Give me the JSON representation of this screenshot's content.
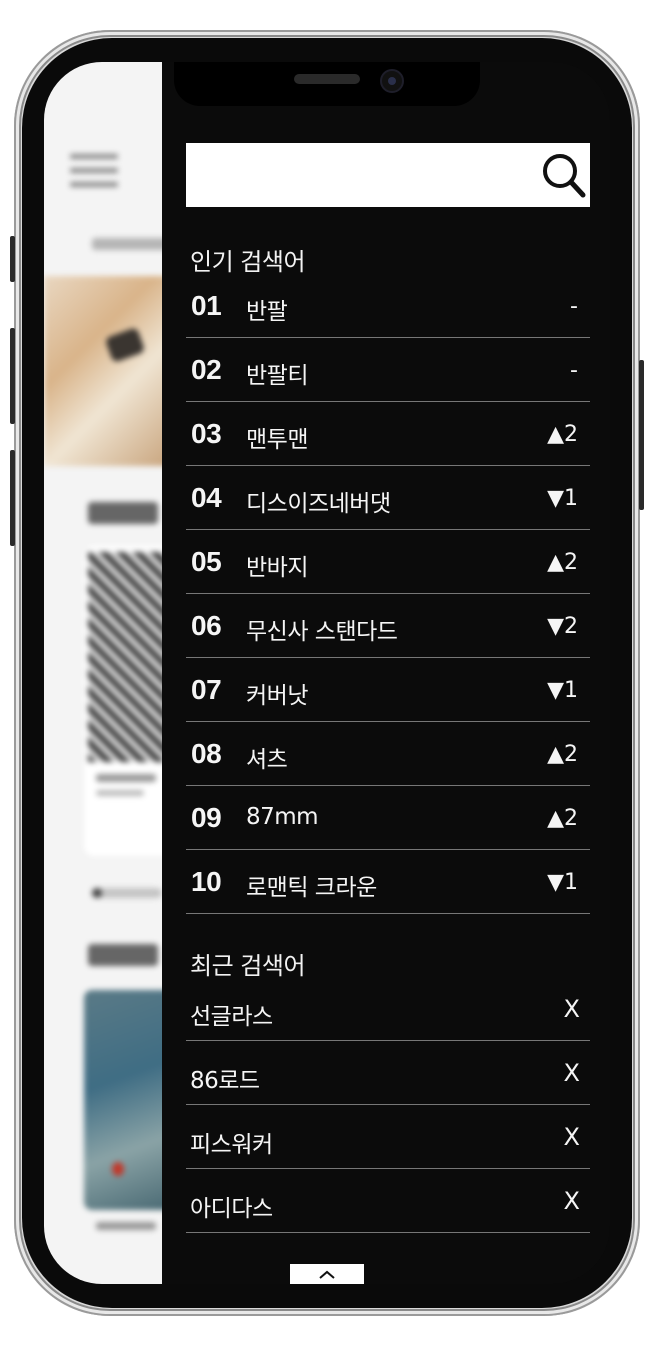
{
  "search": {
    "value": "",
    "placeholder": ""
  },
  "icons": {
    "search": "search-icon",
    "collapse": "chevron-up-icon"
  },
  "popular": {
    "title": "인기 검색어",
    "items": [
      {
        "rank": "01",
        "keyword": "반팔",
        "change": "-"
      },
      {
        "rank": "02",
        "keyword": "반팔티",
        "change": "-"
      },
      {
        "rank": "03",
        "keyword": "맨투맨",
        "change": "▲2"
      },
      {
        "rank": "04",
        "keyword": "디스이즈네버댓",
        "change": "▼1"
      },
      {
        "rank": "05",
        "keyword": "반바지",
        "change": "▲2"
      },
      {
        "rank": "06",
        "keyword": "무신사 스탠다드",
        "change": "▼2"
      },
      {
        "rank": "07",
        "keyword": "커버낫",
        "change": "▼1"
      },
      {
        "rank": "08",
        "keyword": "셔츠",
        "change": "▲2"
      },
      {
        "rank": "09",
        "keyword": "87mm",
        "change": "▲2"
      },
      {
        "rank": "10",
        "keyword": "로맨틱 크라운",
        "change": "▼1"
      }
    ]
  },
  "recent": {
    "title": "최근 검색어",
    "remove_label": "X",
    "items": [
      {
        "keyword": "선글라스"
      },
      {
        "keyword": "86로드"
      },
      {
        "keyword": "피스워커"
      },
      {
        "keyword": "아디다스"
      }
    ]
  },
  "colors": {
    "drawer_bg": "#0b0b0b",
    "text": "#f5f5f5",
    "divider": "#777777"
  }
}
